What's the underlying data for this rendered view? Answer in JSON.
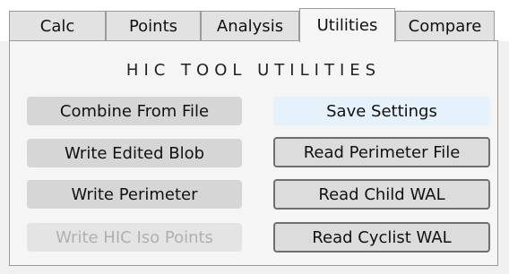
{
  "tabs": [
    {
      "label": "Calc",
      "active": false
    },
    {
      "label": "Points",
      "active": false
    },
    {
      "label": "Analysis",
      "active": false
    },
    {
      "label": "Utilities",
      "active": true
    },
    {
      "label": "Compare",
      "active": false
    }
  ],
  "panel": {
    "title": "HIC TOOL UTILITIES",
    "left_buttons": [
      {
        "label": "Combine From File",
        "enabled": true
      },
      {
        "label": "Write Edited Blob",
        "enabled": true
      },
      {
        "label": "Write Perimeter",
        "enabled": true
      },
      {
        "label": "Write HIC Iso Points",
        "enabled": false
      }
    ],
    "right_buttons": [
      {
        "label": "Save Settings",
        "state": "hover"
      },
      {
        "label": "Read Perimeter File",
        "state": "normal"
      },
      {
        "label": "Read Child WAL",
        "state": "normal"
      },
      {
        "label": "Read Cyclist WAL",
        "state": "normal"
      }
    ]
  },
  "colors": {
    "tab_background": "#e2e2e2",
    "panel_background": "#f5f5f5",
    "button_background": "#d6d6d6",
    "hover_button_background": "#e5f1fb",
    "disabled_text": "#b0b0b0"
  }
}
